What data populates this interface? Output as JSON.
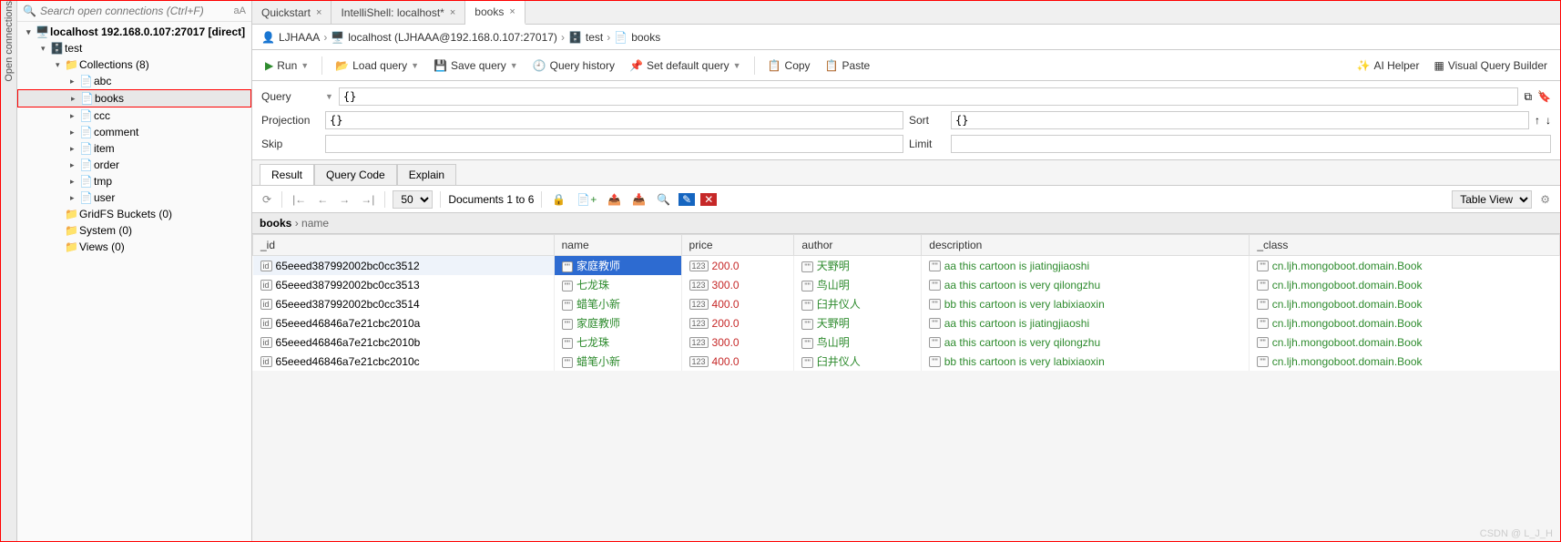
{
  "sidebar": {
    "search_placeholder": "Search open connections (Ctrl+F)",
    "vertical_tab": "Open connections",
    "connection": "localhost 192.168.0.107:27017 [direct]",
    "db": "test",
    "collections_label": "Collections (8)",
    "collections": [
      "abc",
      "books",
      "ccc",
      "comment",
      "item",
      "order",
      "tmp",
      "user"
    ],
    "gridfs": "GridFS Buckets (0)",
    "system": "System (0)",
    "views": "Views (0)"
  },
  "tabs": [
    {
      "label": "Quickstart",
      "active": false
    },
    {
      "label": "IntelliShell: localhost*",
      "active": false
    },
    {
      "label": "books",
      "active": true
    }
  ],
  "breadcrumb": {
    "user": "LJHAAA",
    "host": "localhost (LJHAAA@192.168.0.107:27017)",
    "db": "test",
    "coll": "books"
  },
  "toolbar": {
    "run": "Run",
    "load": "Load query",
    "save": "Save query",
    "history": "Query history",
    "default": "Set default query",
    "copy": "Copy",
    "paste": "Paste",
    "ai": "AI Helper",
    "vqb": "Visual Query Builder"
  },
  "query": {
    "query_label": "Query",
    "query_val": "{}",
    "projection_label": "Projection",
    "projection_val": "{}",
    "sort_label": "Sort",
    "sort_val": "{}",
    "skip_label": "Skip",
    "skip_val": "",
    "limit_label": "Limit",
    "limit_val": ""
  },
  "result_tabs": [
    "Result",
    "Query Code",
    "Explain"
  ],
  "result_toolbar": {
    "page_size": "50",
    "doc_range": "Documents 1 to 6",
    "view_mode": "Table View"
  },
  "table": {
    "path_root": "books",
    "path_sub": "name",
    "columns": [
      "_id",
      "name",
      "price",
      "author",
      "description",
      "_class"
    ],
    "rows": [
      {
        "_id": "65eeed387992002bc0cc3512",
        "name": "家庭教师",
        "price": "200.0",
        "author": "天野明",
        "description": "aa this cartoon is jiatingjiaoshi",
        "_class": "cn.ljh.mongoboot.domain.Book",
        "selected": true
      },
      {
        "_id": "65eeed387992002bc0cc3513",
        "name": "七龙珠",
        "price": "300.0",
        "author": "鸟山明",
        "description": "aa this cartoon is very qilongzhu",
        "_class": "cn.ljh.mongoboot.domain.Book"
      },
      {
        "_id": "65eeed387992002bc0cc3514",
        "name": "蜡笔小新",
        "price": "400.0",
        "author": "臼井仪人",
        "description": "bb this cartoon is very labixiaoxin",
        "_class": "cn.ljh.mongoboot.domain.Book"
      },
      {
        "_id": "65eeed46846a7e21cbc2010a",
        "name": "家庭教师",
        "price": "200.0",
        "author": "天野明",
        "description": "aa this cartoon is jiatingjiaoshi",
        "_class": "cn.ljh.mongoboot.domain.Book"
      },
      {
        "_id": "65eeed46846a7e21cbc2010b",
        "name": "七龙珠",
        "price": "300.0",
        "author": "鸟山明",
        "description": "aa this cartoon is very qilongzhu",
        "_class": "cn.ljh.mongoboot.domain.Book"
      },
      {
        "_id": "65eeed46846a7e21cbc2010c",
        "name": "蜡笔小新",
        "price": "400.0",
        "author": "臼井仪人",
        "description": "bb this cartoon is very labixiaoxin",
        "_class": "cn.ljh.mongoboot.domain.Book"
      }
    ]
  },
  "watermark": "CSDN @ L_J_H"
}
